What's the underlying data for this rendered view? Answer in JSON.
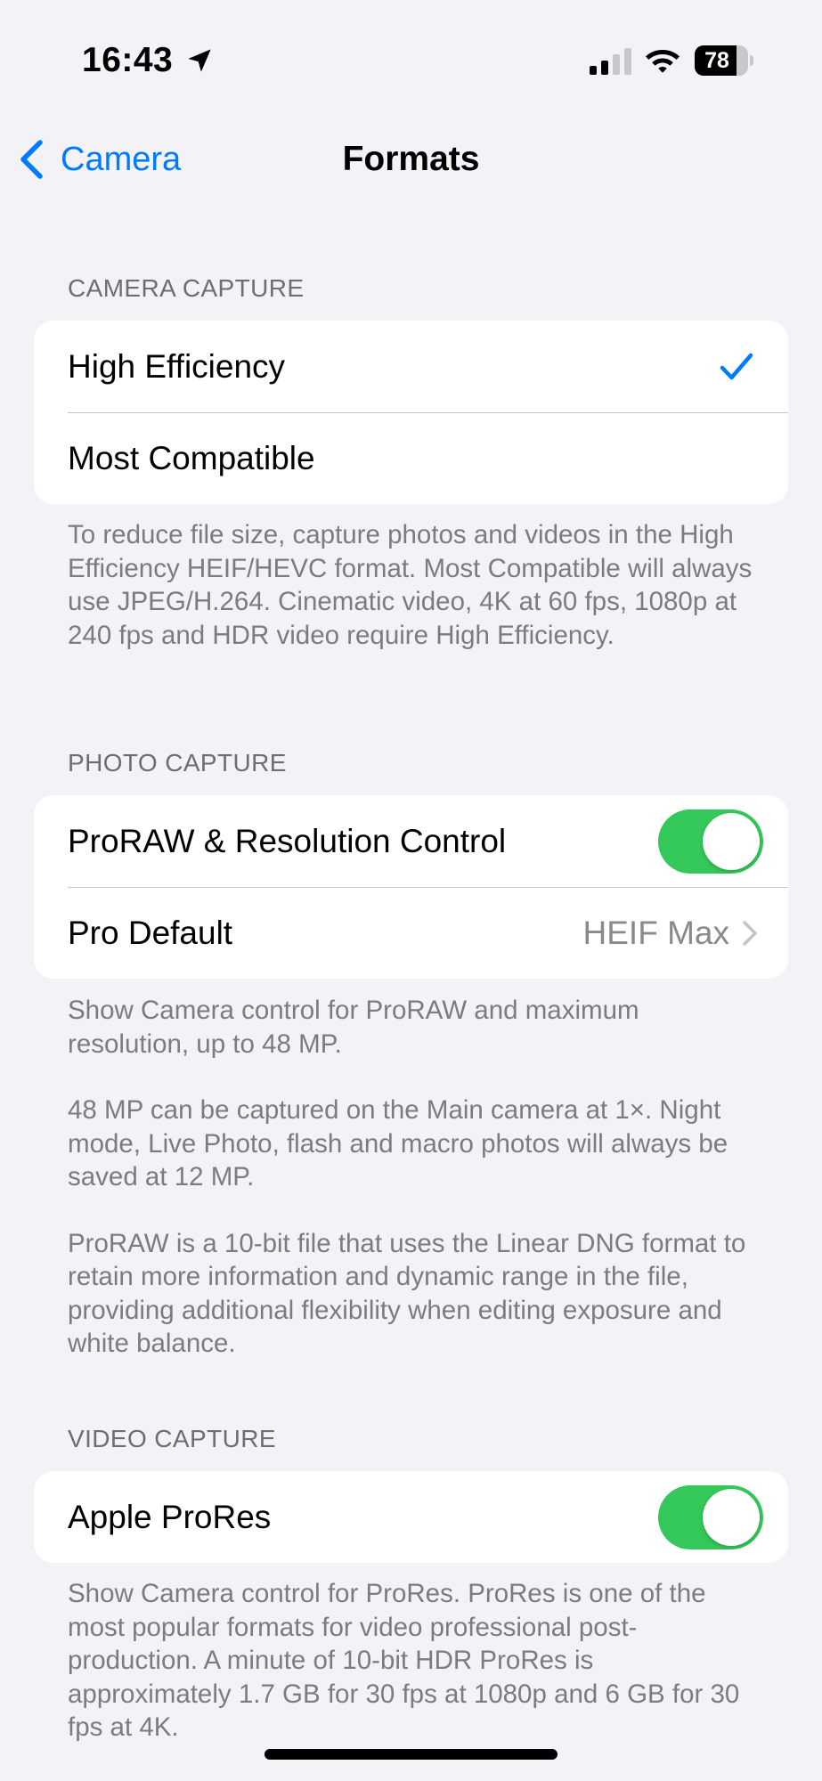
{
  "status_bar": {
    "time": "16:43",
    "battery_level": "78",
    "icons": [
      "location-arrow-icon",
      "cellular-signal-icon",
      "wifi-icon",
      "battery-icon"
    ]
  },
  "nav": {
    "back_label": "Camera",
    "title": "Formats"
  },
  "camera_capture": {
    "header": "CAMERA CAPTURE",
    "options": [
      {
        "label": "High Efficiency",
        "selected": true
      },
      {
        "label": "Most Compatible",
        "selected": false
      }
    ],
    "footer": "To reduce file size, capture photos and videos in the High Efficiency HEIF/HEVC format. Most Compatible will always use JPEG/H.264. Cinematic video, 4K at 60 fps, 1080p at 240 fps and HDR video require High Efficiency."
  },
  "photo_capture": {
    "header": "PHOTO CAPTURE",
    "proraw_label": "ProRAW & Resolution Control",
    "proraw_enabled": true,
    "pro_default_label": "Pro Default",
    "pro_default_value": "HEIF Max",
    "footer": [
      "Show Camera control for ProRAW and maximum resolution, up to 48 MP.",
      "48 MP can be captured on the Main camera at 1×. Night mode, Live Photo, flash and macro photos will always be saved at 12 MP.",
      "ProRAW is a 10-bit file that uses the Linear DNG format to retain more information and dynamic range in the file, providing additional flexibility when editing exposure and white balance."
    ]
  },
  "video_capture": {
    "header": "VIDEO CAPTURE",
    "prores_label": "Apple ProRes",
    "prores_enabled": true,
    "footer": "Show Camera control for ProRes. ProRes is one of the most popular formats for video professional post-production. A minute of 10-bit HDR ProRes is approximately 1.7 GB for 30 fps at 1080p and 6 GB for 30 fps at 4K."
  },
  "colors": {
    "accent": "#007aff",
    "toggle_on": "#34c759",
    "background": "#f2f2f7",
    "secondary_text": "#7b7b80"
  }
}
